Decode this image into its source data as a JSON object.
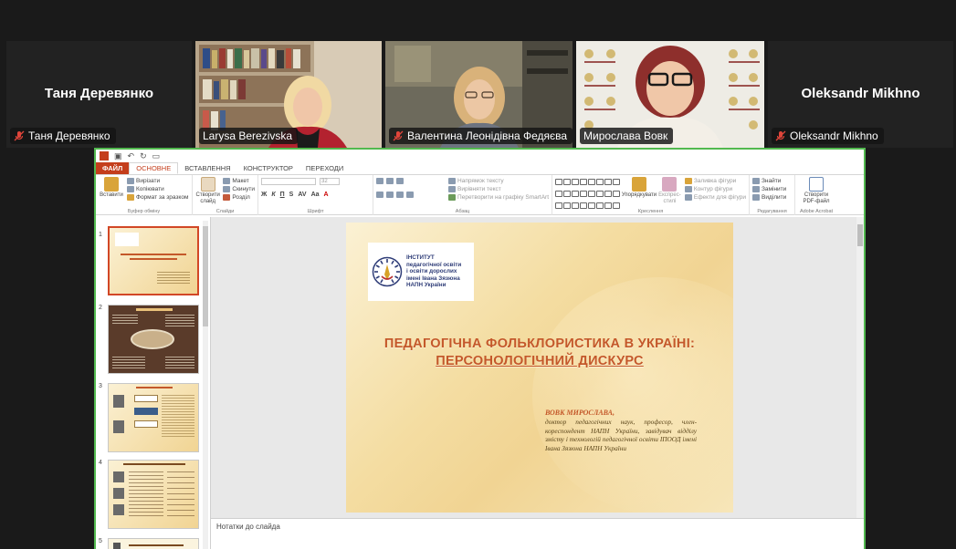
{
  "participants": [
    {
      "name": "Таня Деревянко",
      "label": "Таня Деревянко",
      "muted": true,
      "video": false
    },
    {
      "name": "Larysa Berezivska",
      "label": "Larysa Berezivska",
      "muted": false,
      "video": true
    },
    {
      "name": "Валентина Леонідівна Федяєва",
      "label": "Валентина Леонідівна Федяєва",
      "muted": true,
      "video": true
    },
    {
      "name": "Мирослава Вовк",
      "label": "Мирослава Вовк",
      "muted": false,
      "video": true,
      "active_speaker": true
    },
    {
      "name": "Oleksandr Mikhno",
      "label": "Oleksandr Mikhno",
      "muted": true,
      "video": false
    }
  ],
  "ppt": {
    "tabs": [
      "ФАЙЛ",
      "ОСНОВНЕ",
      "ВСТАВЛЕННЯ",
      "КОНСТРУКТОР",
      "ПЕРЕХОДИ"
    ],
    "selected_tab": "ОСНОВНЕ",
    "ribbon": {
      "clipboard": {
        "paste": "Вставити",
        "cut": "Вирізати",
        "copy": "Копіювати",
        "format": "Формат за зразком",
        "label": "Буфер обміну"
      },
      "slides": {
        "new_slide": "Створити слайд",
        "layout": "Макет",
        "reset": "Скинути",
        "section": "Розділ",
        "label": "Слайди"
      },
      "font": {
        "size": "32",
        "label": "Шрифт"
      },
      "paragraph": {
        "direction": "Напрямок тексту",
        "align": "Вирівняти текст",
        "smartart": "Перетворити на графіку SmartArt",
        "label": "Абзац"
      },
      "drawing": {
        "arrange": "Упорядкувати",
        "styles": "Експрес-стилі",
        "fill": "Заливка фігури",
        "outline": "Контур фігури",
        "effects": "Ефекти для фігури",
        "label": "Креслення"
      },
      "editing": {
        "find": "Знайти",
        "replace": "Замінити",
        "select": "Виділити",
        "label": "Редагування"
      },
      "acrobat": {
        "create": "Створити PDF-файл",
        "label": "Adobe Acrobat"
      }
    },
    "slide_numbers": [
      "1",
      "2",
      "3",
      "4",
      "5"
    ],
    "notes_placeholder": "Нотатки до слайда",
    "slide": {
      "logo_lines": [
        "ІНСТИТУТ",
        "педагогічної освіти",
        "і освіти дорослих",
        "імені Івана Зязюна",
        "НАПН України"
      ],
      "title_line1": "ПЕДАГОГІЧНА ФОЛЬКЛОРИСТИКА В УКРАЇНІ:",
      "title_line2": "ПЕРСОНОЛОГІЧНИЙ ДИСКУРС",
      "author": "ВОВК МИРОСЛАВА,",
      "description": "доктор педагогічних наук, професор, член-кореспондент НАПН України, завідувач відділу змісту і технологій педагогічної освіти ІПООД імені Івана Зязюна НАПН України"
    }
  }
}
